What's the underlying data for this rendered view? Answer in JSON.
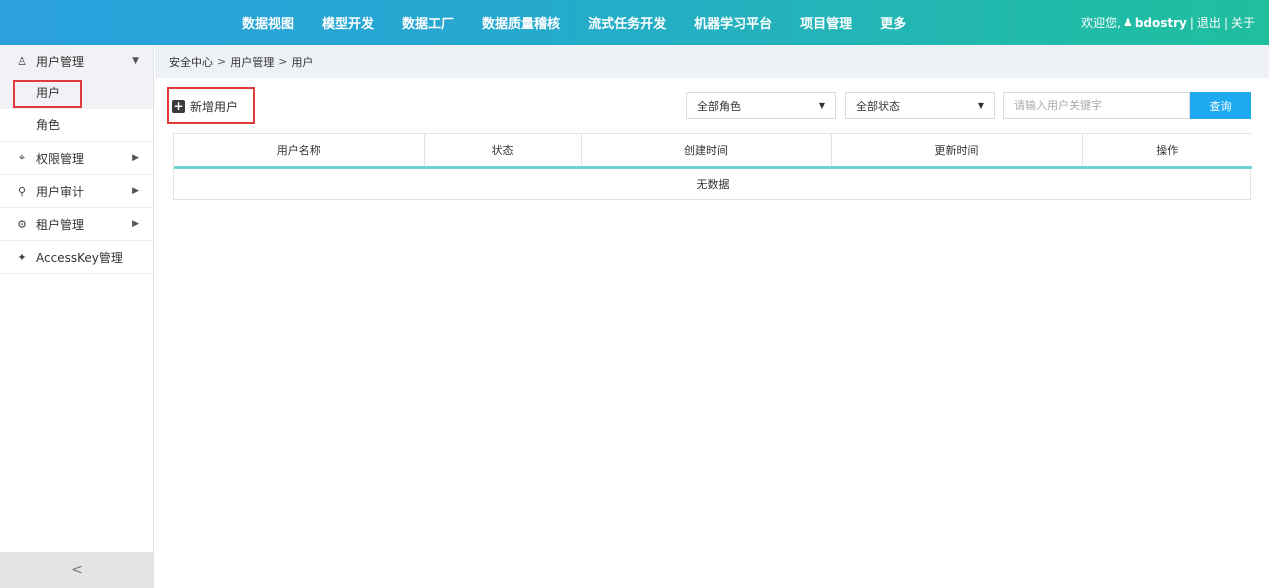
{
  "topnav": {
    "items": [
      "数据视图",
      "模型开发",
      "数据工厂",
      "数据质量稽核",
      "流式任务开发",
      "机器学习平台",
      "项目管理",
      "更多"
    ]
  },
  "user": {
    "welcome": "欢迎您,",
    "icon": "user-icon",
    "name": "bdostry",
    "separator": "|",
    "logout": "退出",
    "about": "关于"
  },
  "sidebar": {
    "groups": [
      {
        "label": "用户管理",
        "icon": "users-icon",
        "expanded": true,
        "children": [
          "用户",
          "角色"
        ]
      },
      {
        "label": "权限管理",
        "icon": "key-icon",
        "expanded": false
      },
      {
        "label": "用户审计",
        "icon": "search-icon",
        "expanded": false
      },
      {
        "label": "租户管理",
        "icon": "gear-icon",
        "expanded": false
      },
      {
        "label": "AccessKey管理",
        "icon": "pin-icon",
        "expanded": false
      }
    ],
    "collapse_glyph": "<"
  },
  "breadcrumb": [
    "安全中心",
    "用户管理",
    "用户"
  ],
  "breadcrumb_sep": ">",
  "toolbar": {
    "add_label": "新增用户",
    "role_select": "全部角色",
    "status_select": "全部状态",
    "search_placeholder": "请输入用户关键字",
    "search_label": "查询"
  },
  "table": {
    "columns": [
      "用户名称",
      "状态",
      "创建时间",
      "更新时间",
      "操作"
    ],
    "empty_text": "无数据"
  },
  "colors": {
    "accent": "#1eaaf1",
    "highlight": "#e03b3b",
    "table_header_line": "#6dd3d3"
  }
}
